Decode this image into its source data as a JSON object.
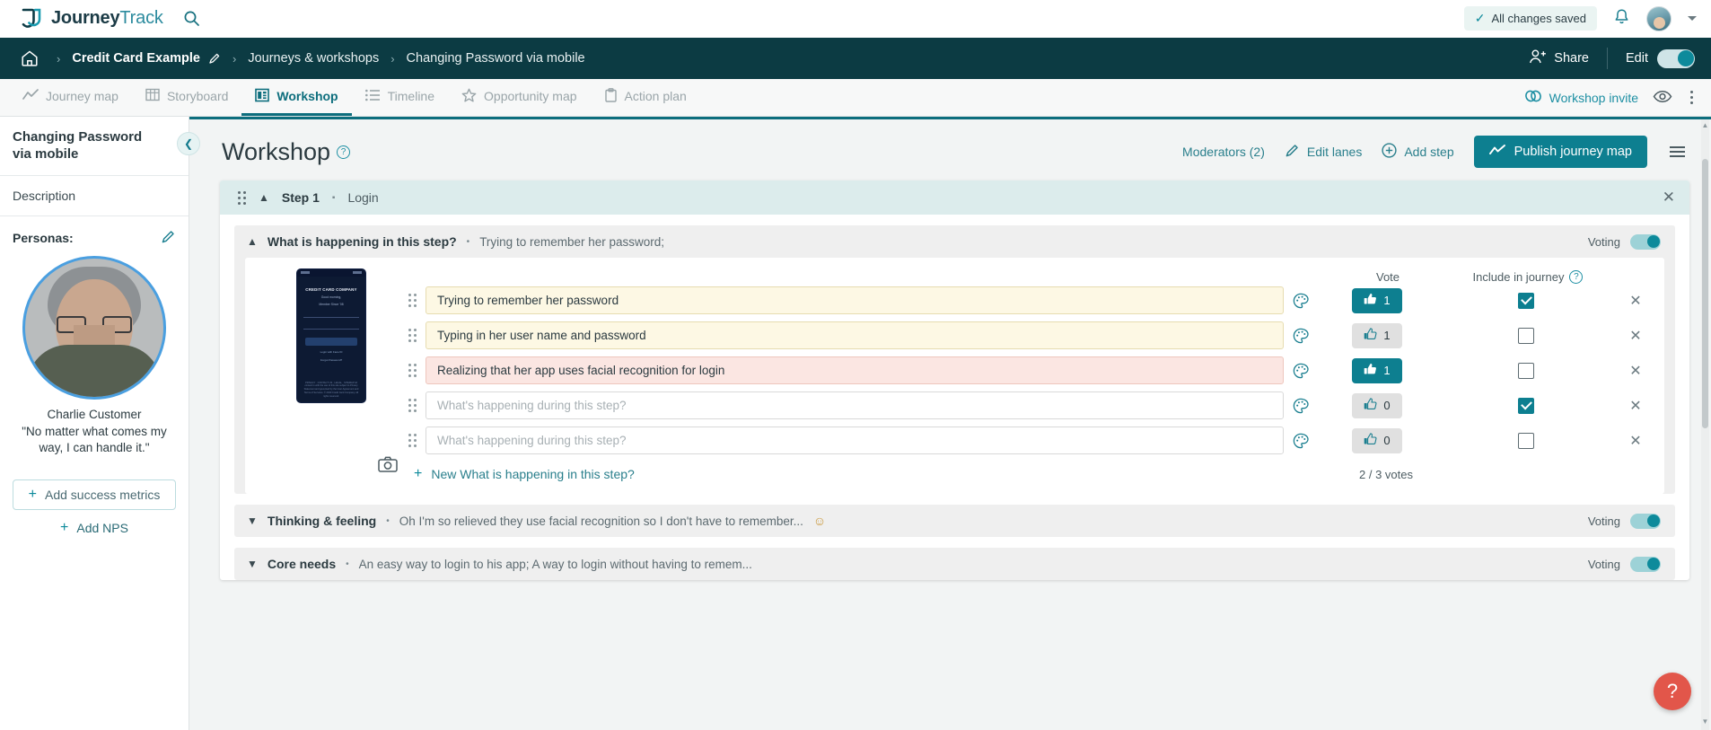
{
  "brand": {
    "name_bold": "Journey",
    "name_light": "Track",
    "accent": "#0d8a9b",
    "dark": "#0c3b43"
  },
  "topbar": {
    "search_icon": "search-icon",
    "saved_text": "All changes saved",
    "bell_icon": "bell-icon",
    "avatar_alt": "user-avatar"
  },
  "breadcrumb": {
    "home": "home-icon",
    "items": [
      {
        "label": "Credit Card Example",
        "strong": true
      },
      {
        "label": "Journeys & workshops",
        "strong": false
      },
      {
        "label": "Changing Password via mobile",
        "strong": false
      }
    ],
    "separator": "›",
    "share_label": "Share",
    "edit_label": "Edit",
    "edit_toggle_on": true
  },
  "tabs": [
    {
      "label": "Journey map",
      "icon": "trend-line-icon",
      "active": false
    },
    {
      "label": "Storyboard",
      "icon": "grid-icon",
      "active": false
    },
    {
      "label": "Workshop",
      "icon": "layout-panels-icon",
      "active": true
    },
    {
      "label": "Timeline",
      "icon": "list-icon",
      "active": false
    },
    {
      "label": "Opportunity map",
      "icon": "star-icon",
      "active": false
    },
    {
      "label": "Action plan",
      "icon": "clipboard-icon",
      "active": false
    }
  ],
  "tabbar_right": {
    "invite_label": "Workshop invite",
    "invite_icon": "link-icon",
    "preview_icon": "eye-icon",
    "more_icon": "more-vertical-icon"
  },
  "sidebar": {
    "title": "Changing Password via mobile",
    "description_label": "Description",
    "personas_label": "Personas:",
    "edit_icon": "pencil-icon",
    "persona": {
      "name": "Charlie Customer",
      "quote": "\"No matter what comes my way, I can handle it.\""
    },
    "add_metrics_label": "Add success metrics",
    "add_nps_label": "Add NPS",
    "collapse_icon": "chevron-left-icon"
  },
  "main": {
    "title": "Workshop",
    "help_icon": "help-circle-icon",
    "actions": [
      {
        "label": "Moderators (2)",
        "icon": ""
      },
      {
        "label": "Edit lanes",
        "icon": "pencil-icon"
      },
      {
        "label": "Add step",
        "icon": "plus-circle-icon"
      }
    ],
    "publish_label": "Publish journey map",
    "publish_icon": "trend-line-icon",
    "menu_icon": "hamburger-icon"
  },
  "step": {
    "label": "Step 1",
    "dot": "▪",
    "name": "Login",
    "close_icon": "close-icon",
    "drag_icon": "drag-handle-icon",
    "collapse_icon": "chevron-up-icon"
  },
  "sections": [
    {
      "title": "What is happening in this step?",
      "dot": "•",
      "summary": "Trying to remember her password;",
      "voting_label": "Voting",
      "voting_on": true,
      "expanded": true,
      "column_headers": {
        "vote": "Vote",
        "include": "Include in journey"
      },
      "include_help_icon": "help-circle-icon",
      "rows": [
        {
          "text": "Trying to remember her password",
          "placeholder": "",
          "color": "yellow",
          "votes": 1,
          "voted": true,
          "include": true
        },
        {
          "text": "Typing in her user name and password",
          "placeholder": "",
          "color": "yellow",
          "votes": 1,
          "voted": false,
          "include": false
        },
        {
          "text": "Realizing that her app uses facial recognition for login",
          "placeholder": "",
          "color": "pink",
          "votes": 1,
          "voted": true,
          "include": false
        },
        {
          "text": "",
          "placeholder": "What's happening during this step?",
          "color": "plain",
          "votes": 0,
          "voted": false,
          "include": true
        },
        {
          "text": "",
          "placeholder": "What's happening during this step?",
          "color": "plain",
          "votes": 0,
          "voted": false,
          "include": false
        }
      ],
      "new_item_label": "New What is happening in this step?",
      "votes_summary": "2 / 3 votes",
      "phone": {
        "title": "CREDIT CARD COMPANY",
        "greeting": "Good morning,",
        "subtitle": "Member Since '08",
        "button": "Log in",
        "link1": "Login with Face ID",
        "link2": "Forgot Password?",
        "footer": "PRIVACY · CONTACT US · LEGAL · SITEMAP\nAll content is with the use of this site subject to Privacy Statement and governed by the User Agreement and Terms of Services.\n© 2020 Credit Card Company. All rights reserved.",
        "camera_icon": "camera-icon"
      }
    },
    {
      "title": "Thinking & feeling",
      "dot": "•",
      "summary": "Oh I'm so relieved they use facial recognition so I don't have to remember...",
      "emoji": "☺",
      "voting_label": "Voting",
      "voting_on": true,
      "expanded": false
    },
    {
      "title": "Core needs",
      "dot": "•",
      "summary": "An easy way to login to his app; A way to login without having to remem...",
      "voting_label": "Voting",
      "voting_on": true,
      "expanded": false
    }
  ],
  "help_fab": {
    "label": "?"
  }
}
